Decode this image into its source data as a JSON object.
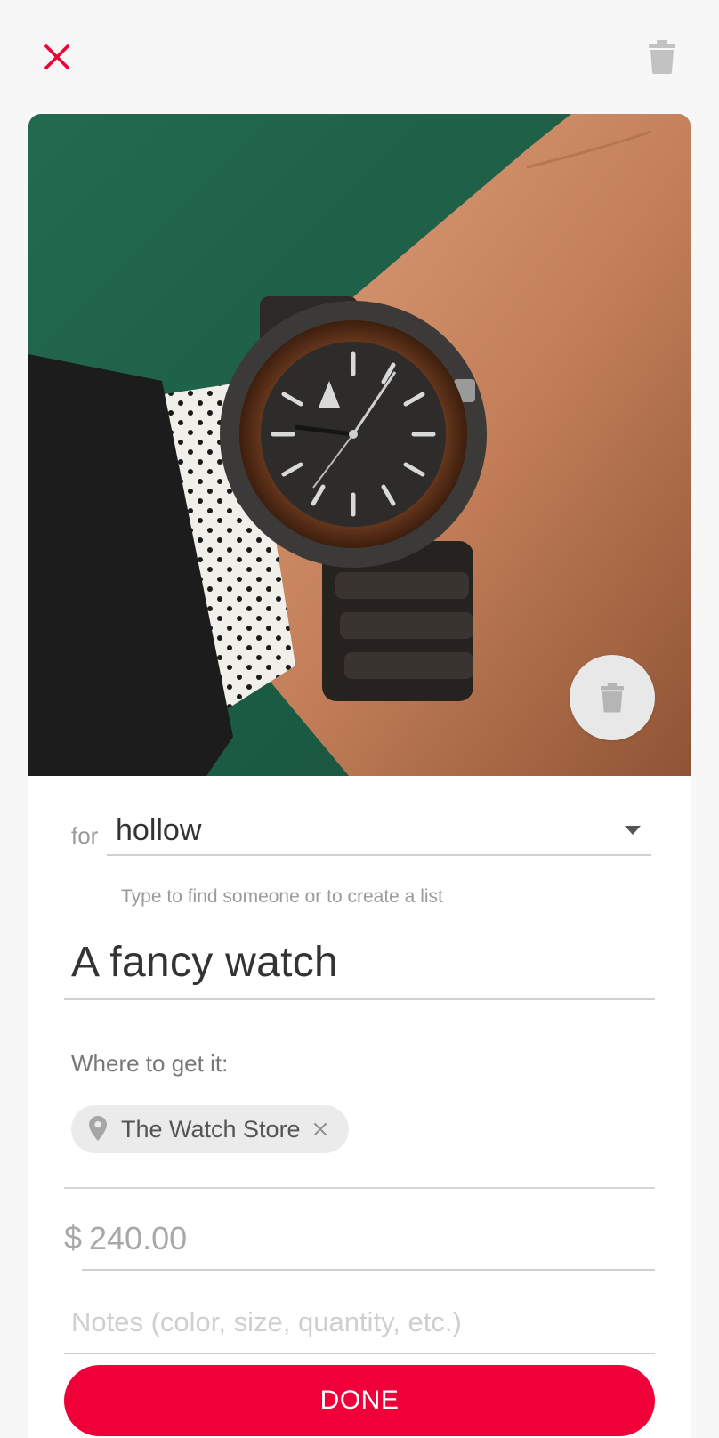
{
  "colors": {
    "accent": "#ef0038",
    "background": "#f7f7f7",
    "card": "#ffffff"
  },
  "header": {
    "close_icon": "close-icon",
    "delete_icon": "trash-icon"
  },
  "photo": {
    "subject": "wood watch on wrist",
    "delete_icon": "trash-icon"
  },
  "recipient": {
    "prefix": "for",
    "value": "hollow",
    "helper": "Type to find someone or to create a list"
  },
  "item": {
    "title": "A fancy watch"
  },
  "where": {
    "label": "Where to get it:",
    "stores": [
      {
        "name": "The Watch Store",
        "icon": "pin-icon"
      }
    ]
  },
  "price": {
    "currency": "$",
    "value": "240.00"
  },
  "notes": {
    "placeholder": "Notes (color, size, quantity, etc.)"
  },
  "actions": {
    "done_label": "DONE"
  }
}
